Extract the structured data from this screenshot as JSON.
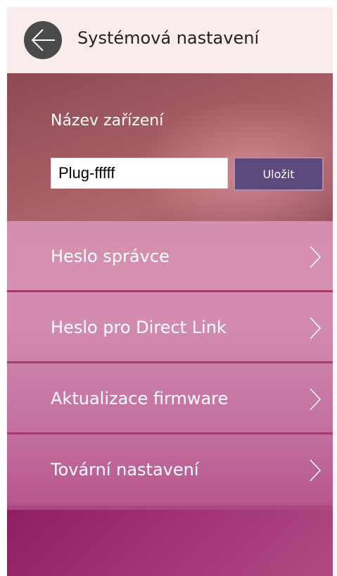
{
  "header": {
    "title": "Systémová nastavení",
    "back_icon": "arrow-left-icon"
  },
  "device": {
    "label": "Název zařízení",
    "name_value": "Plug-fffff",
    "save_label": "Uložit"
  },
  "menu": {
    "items": [
      {
        "label": "Heslo správce",
        "icon": "chevron-right-icon"
      },
      {
        "label": "Heslo pro Direct Link",
        "icon": "chevron-right-icon"
      },
      {
        "label": "Aktualizace firmware",
        "icon": "chevron-right-icon"
      },
      {
        "label": "Tovární nastavení",
        "icon": "chevron-right-icon"
      }
    ]
  },
  "colors": {
    "header_bg": "#f8ecec",
    "back_button": "#4a4a4a",
    "save_button": "#5b4a7e",
    "divider": "#a63a6a",
    "text_light": "#ffffff"
  }
}
